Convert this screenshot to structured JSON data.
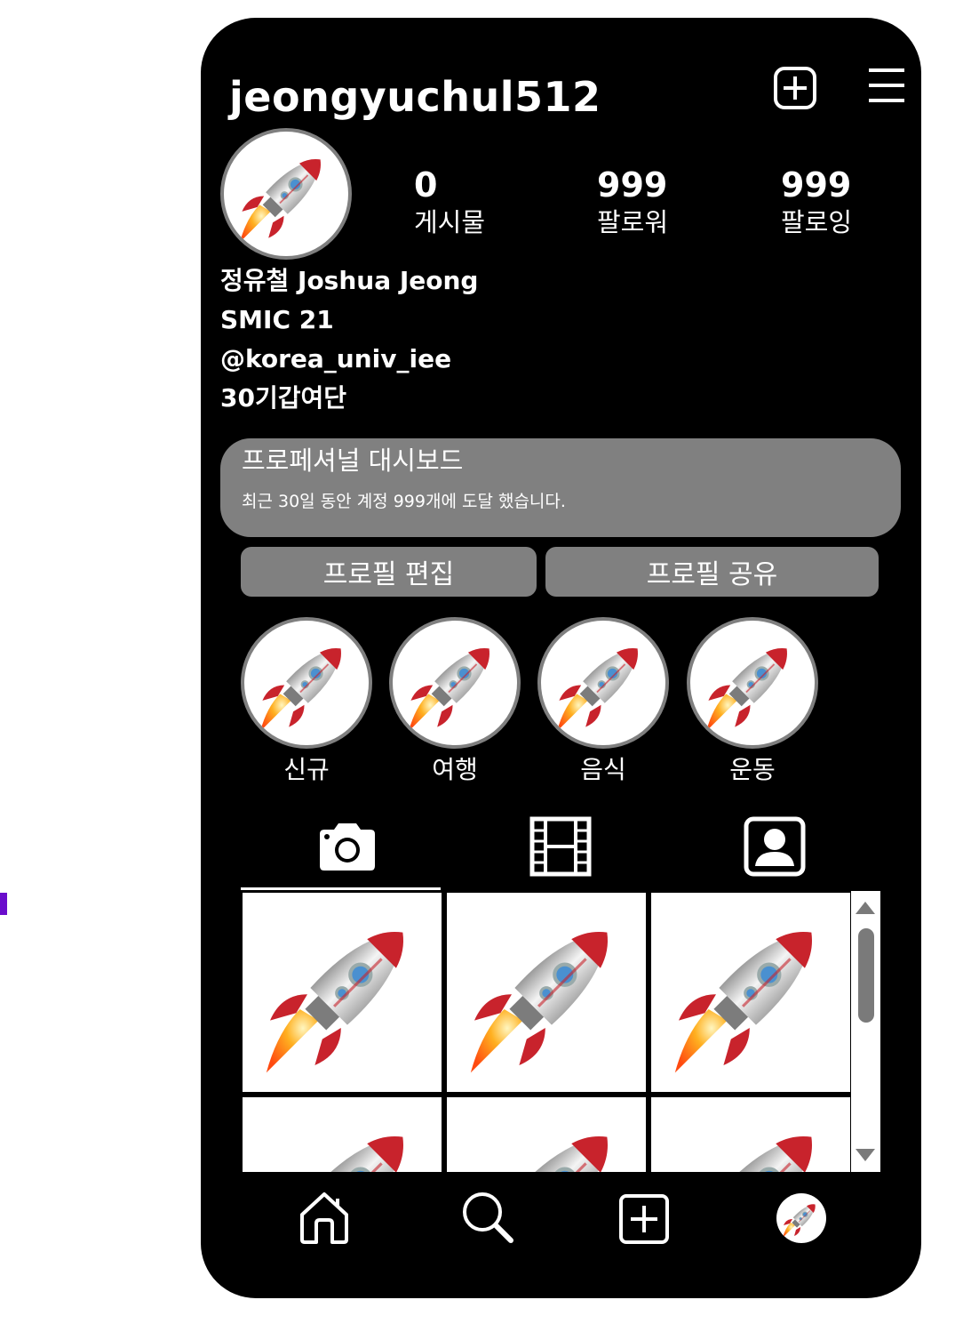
{
  "profile": {
    "username": "jeongyuchul512",
    "stats": [
      {
        "value": "0",
        "label": "게시물"
      },
      {
        "value": "999",
        "label": "팔로워"
      },
      {
        "value": "999",
        "label": "팔로잉"
      }
    ],
    "bio": [
      "정유철 Joshua Jeong",
      "SMIC 21",
      "@korea_univ_iee",
      "30기갑여단"
    ]
  },
  "dashboard": {
    "title": "프로페셔널 대시보드",
    "text": "최근 30일 동안 계정 999개에 도달 했습니다."
  },
  "buttons": {
    "edit_profile": "프로필 편집",
    "share_profile": "프로필 공유"
  },
  "highlights": [
    {
      "label": "신규"
    },
    {
      "label": "여행"
    },
    {
      "label": "음식"
    },
    {
      "label": "운동"
    }
  ],
  "tabs": [
    {
      "icon": "camera-icon",
      "active": true
    },
    {
      "icon": "film-icon",
      "active": false
    },
    {
      "icon": "tagged-person-icon",
      "active": false
    }
  ],
  "bottom_nav": [
    {
      "icon": "home-icon"
    },
    {
      "icon": "search-icon"
    },
    {
      "icon": "add-post-icon"
    },
    {
      "icon": "profile-avatar"
    }
  ],
  "colors": {
    "background": "#000000",
    "panel": "#808080",
    "accent_marker": "#6a0dcc"
  }
}
